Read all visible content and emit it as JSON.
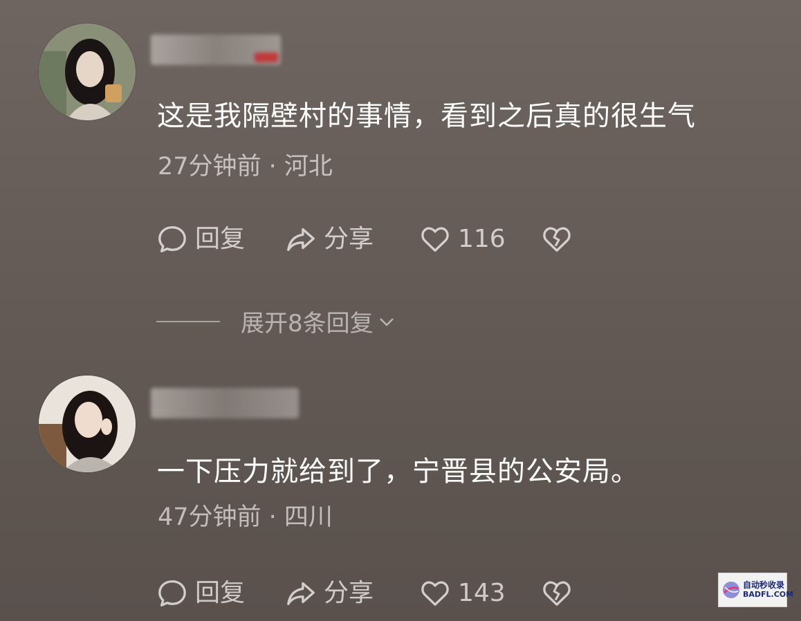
{
  "comments": [
    {
      "text": "这是我隔壁村的事情，看到之后真的很生气",
      "meta": "27分钟前 · 河北",
      "actions": {
        "reply": "回复",
        "share": "分享",
        "likes": "116"
      }
    },
    {
      "text": "一下压力就给到了，宁晋县的公安局。",
      "meta": "47分钟前 · 四川",
      "actions": {
        "reply": "回复",
        "share": "分享",
        "likes": "143"
      }
    }
  ],
  "expand_replies": {
    "label": "展开8条回复"
  },
  "watermark": {
    "line1": "自动秒收录",
    "line2": "BADFL.COM"
  },
  "icons": {
    "reply": "speech-bubble-icon",
    "share": "share-arrow-icon",
    "like": "heart-outline-icon",
    "dislike": "broken-heart-icon",
    "expand": "chevron-down-icon"
  }
}
